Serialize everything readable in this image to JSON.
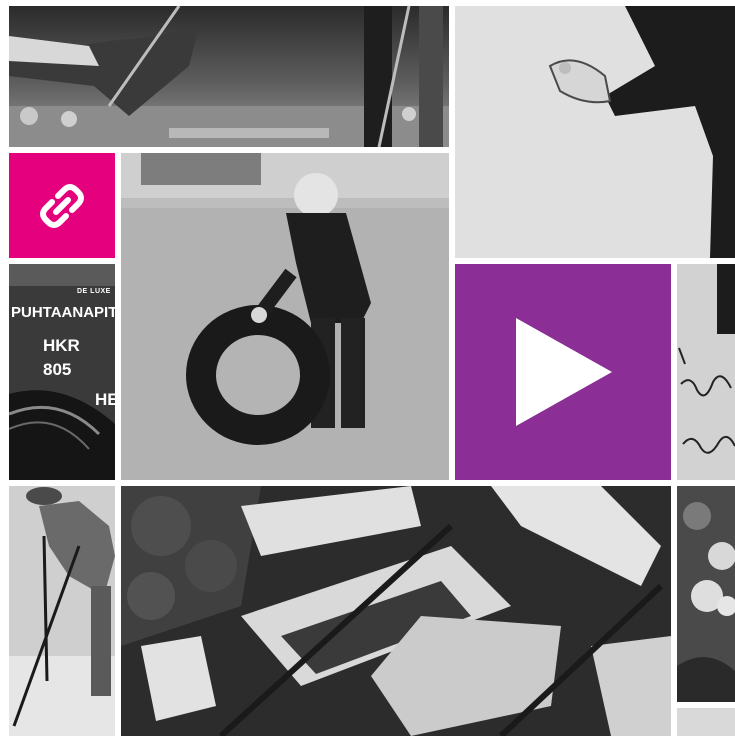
{
  "colors": {
    "link_tile": "#e5007d",
    "play_tile": "#8b2f96",
    "gap": "#ffffff"
  },
  "link_tile": {
    "icon": "link-icon"
  },
  "play_tile": {
    "icon": "play-icon"
  },
  "photos": [
    {
      "name": "photo-children-on-swings"
    },
    {
      "name": "photo-man-in-suit-gesturing"
    },
    {
      "name": "photo-boy-rolling-tire"
    },
    {
      "name": "photo-vintage-vehicle-plate"
    },
    {
      "name": "photo-handwritten-letter"
    },
    {
      "name": "photo-skier-with-poles"
    },
    {
      "name": "photo-aerial-city-blocks"
    },
    {
      "name": "photo-flowers"
    }
  ],
  "vehicle_plate": {
    "brand": "DE LUXE",
    "line1": "PUHTAANAPITO",
    "line2": "HKR",
    "line3": "805",
    "line4": "HE"
  }
}
